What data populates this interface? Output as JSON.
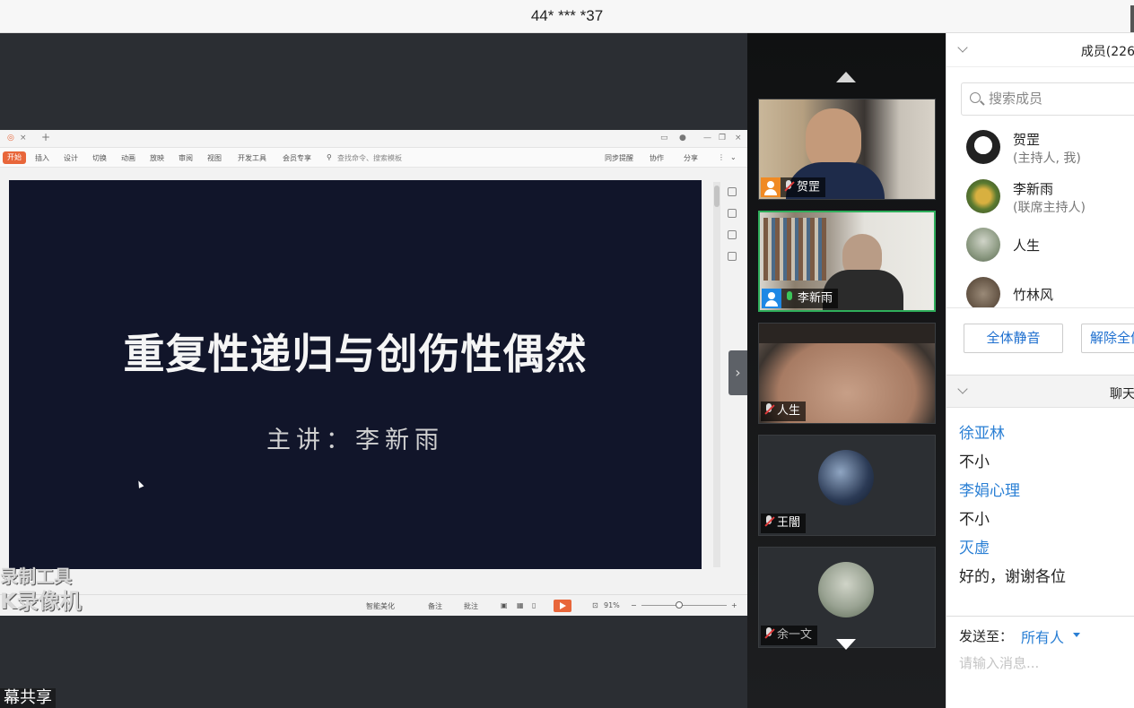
{
  "window": {
    "title": "44* *** *37"
  },
  "wps": {
    "ribbon_tabs": [
      "开始",
      "插入",
      "设计",
      "切换",
      "动画",
      "放映",
      "审阅",
      "视图",
      "开发工具",
      "会员专享"
    ],
    "search_placeholder": "查找命令、搜索模板",
    "right_tools": [
      "同步提醒",
      "协作",
      "分享"
    ],
    "status_items": [
      "智能美化",
      "备注",
      "批注"
    ],
    "zoom": "91%"
  },
  "slide": {
    "title": "重复性递归与创伤性偶然",
    "subtitle": "主讲：李新雨"
  },
  "watermark": {
    "line1": "录制工具",
    "line2": "K录像机"
  },
  "share_label": "幕共享",
  "videos": [
    {
      "name": "贺罡",
      "mic": "muted",
      "icon": "orange"
    },
    {
      "name": "李新雨",
      "mic": "active",
      "icon": "blue"
    },
    {
      "name": "人生",
      "mic": "muted"
    },
    {
      "name": "王闇",
      "mic": "muted"
    },
    {
      "name": "余一文",
      "mic": "muted"
    }
  ],
  "members_panel": {
    "title": "成员(226",
    "search_placeholder": "搜索成员",
    "members": [
      {
        "name": "贺罡",
        "role": "(主持人, 我)"
      },
      {
        "name": "李新雨",
        "role": "(联席主持人)"
      },
      {
        "name": "人生",
        "role": ""
      },
      {
        "name": "竹林风",
        "role": ""
      }
    ],
    "mute_all": "全体静音",
    "unmute_all": "解除全体静音"
  },
  "chat_panel": {
    "title": "聊天",
    "messages": [
      {
        "sender": "徐亚林",
        "text": "不小"
      },
      {
        "sender": "李娟心理",
        "text": "不小"
      },
      {
        "sender": "灭虚",
        "text": "好的，谢谢各位"
      }
    ],
    "send_to_label": "发送至：",
    "send_to_target": "所有人",
    "input_placeholder": "请输入消息..."
  },
  "colors": {
    "accent": "#2a7fd4",
    "active_speaker": "#2fae5b",
    "slide_bg": "#11152a"
  }
}
